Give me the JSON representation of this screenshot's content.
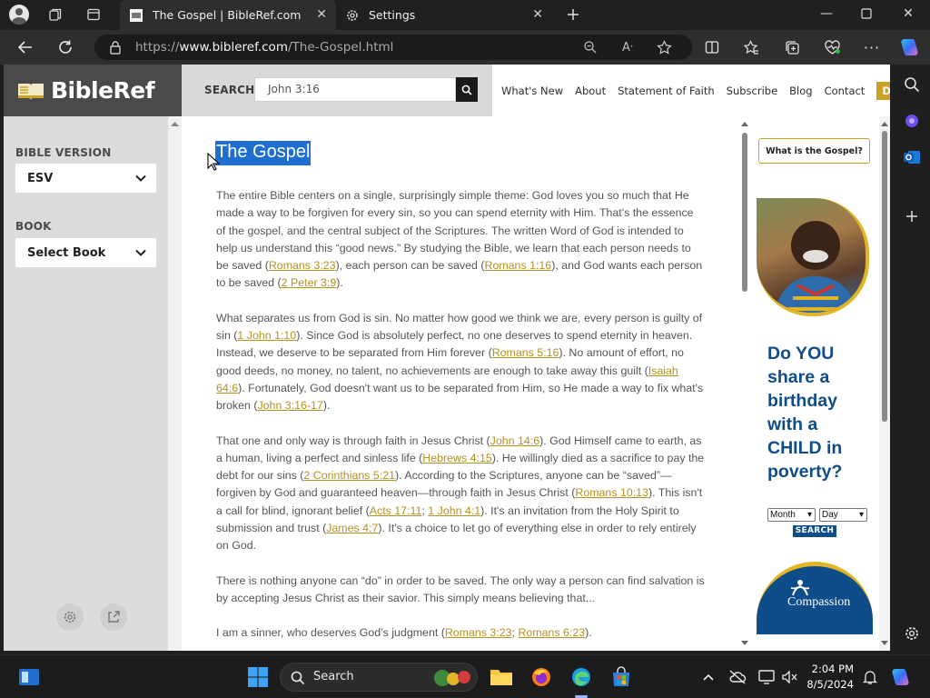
{
  "browser": {
    "tabs": [
      {
        "title": "The Gospel | BibleRef.com",
        "active": true
      },
      {
        "title": "Settings",
        "active": false
      }
    ],
    "address": {
      "prefix": "https://",
      "domain": "www.bibleref.com",
      "path": "/The-Gospel.html"
    },
    "icons": [
      "profile-icon",
      "workspaces-icon",
      "tab-actions-icon",
      "new-tab-icon",
      "back-icon",
      "refresh-icon",
      "lock-icon",
      "zoom-icon",
      "read-aloud-icon",
      "favorite-star-icon",
      "split-screen-icon",
      "favorites-icon",
      "collections-icon",
      "performance-icon",
      "more-icon",
      "copilot-icon"
    ]
  },
  "site": {
    "logo": "BibleRef",
    "search": {
      "label": "SEARCH",
      "value": "John 3:16"
    },
    "nav": [
      "What's New",
      "About",
      "Statement of Faith",
      "Subscribe",
      "Blog",
      "Contact"
    ],
    "donate": "Donate"
  },
  "sidebar": {
    "version_label": "BIBLE VERSION",
    "version_value": "ESV",
    "book_label": "BOOK",
    "book_value": "Select Book"
  },
  "article": {
    "title": "The Gospel",
    "p1": {
      "t1": "The entire Bible centers on a single, surprisingly simple theme: God loves you so much that He made a way to be forgiven for every sin, so you can spend eternity with Him. That's the essence of the gospel, and the central subject of the Scriptures. The written Word of God is intended to help us understand this “good news.” By studying the Bible, we learn that each person needs to be saved (",
      "r1": "Romans 3:23",
      "t2": "), each person can be saved (",
      "r2": "Romans 1:16",
      "t3": "), and God wants each person to be saved (",
      "r3": "2 Peter 3:9",
      "t4": ")."
    },
    "p2": {
      "t1": "What separates us from God is sin. No matter how good we think we are, every person is guilty of sin (",
      "r1": "1 John 1:10",
      "t2": "). Since God is absolutely perfect, no one deserves to spend eternity in heaven. Instead, we deserve to be separated from Him forever (",
      "r2": "Romans 5:16",
      "t3": "). No amount of effort, no good deeds, no money, no talent, no achievements are enough to take away this guilt (",
      "r3": "Isaiah 64:6",
      "t4": "). Fortunately, God doesn't want us to be separated from Him, so He made a way to fix what's broken (",
      "r4": "John 3:16-17",
      "t5": ")."
    },
    "p3": {
      "t1": "That one and only way is through faith in Jesus Christ (",
      "r1": "John 14:6",
      "t2": "). God Himself came to earth, as a human, living a perfect and sinless life (",
      "r2": "Hebrews 4:15",
      "t3": "). He willingly died as a sacrifice to pay the debt for our sins (",
      "r3": "2 Corinthians 5:21",
      "t4": "). According to the Scriptures, anyone can be “saved”—forgiven by God and guaranteed heaven—through faith in Jesus Christ (",
      "r4": "Romans 10:13",
      "t5": "). This isn't a call for blind, ignorant belief (",
      "r5": "Acts 17:11",
      "t6": "; ",
      "r6": "1 John 4:1",
      "t7": "). It's an invitation from the Holy Spirit to submission and trust (",
      "r7": "James 4:7",
      "t8": "). It's a choice to let go of everything else in order to rely entirely on God."
    },
    "p4": "There is nothing anyone can “do” in order to be saved. The only way a person can find salvation is by accepting Jesus Christ as their savior. This simply means believing that...",
    "p5": {
      "t1": "I am a sinner, who deserves God’s judgment (",
      "r1": "Romans 3:23",
      "t2": "; ",
      "r2": "Romans 6:23",
      "t3": ")."
    }
  },
  "right_col": {
    "gospel_btn": "What is the Gospel?",
    "ad_text": "Do YOU share a birthday with a CHILD in poverty?",
    "month": "Month",
    "day": "Day",
    "search": "SEARCH",
    "logo": "Compassion"
  },
  "taskbar": {
    "search": "Search",
    "time": "2:04 PM",
    "date": "8/5/2024"
  },
  "colors": {
    "accent_gold": "#c9a227",
    "link": "#b59022",
    "ad_blue": "#0f4d8a",
    "selection": "#1f6fd1"
  }
}
